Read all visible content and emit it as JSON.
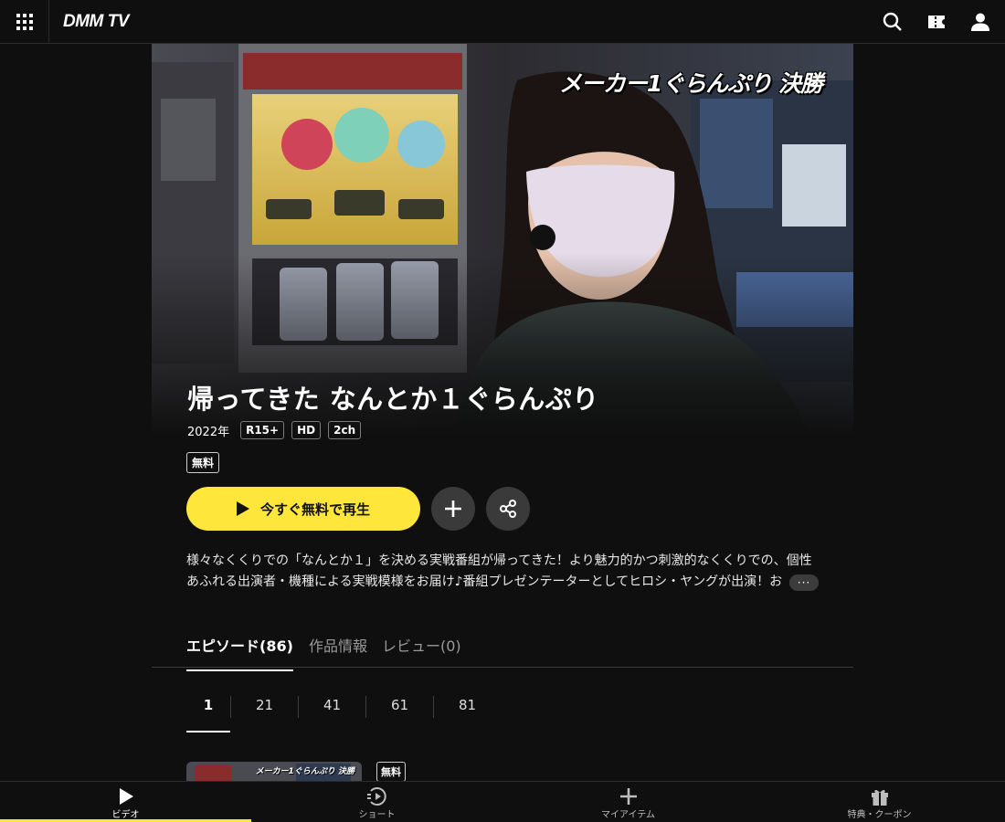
{
  "header": {
    "logo": "DMM TV",
    "menu_icon": "grid-menu-icon",
    "icons": [
      "search-icon",
      "ticket-icon",
      "user-icon"
    ]
  },
  "hero": {
    "caption": "メーカー1ぐらんぷり 決勝"
  },
  "title": "帰ってきた なんとか１ぐらんぷり",
  "meta": {
    "year": "2022年",
    "tags": [
      "R15+",
      "HD",
      "2ch"
    ]
  },
  "free_badge": "無料",
  "actions": {
    "play_label": "今すぐ無料で再生",
    "add_icon": "plus-icon",
    "share_icon": "share-icon"
  },
  "description": {
    "line1": "様々なくくりでの「なんとか１」を決める実戦番組が帰ってきた！より魅力的かつ刺激的なくくりでの、個性",
    "line2": "あふれる出演者・機種による実戦模様をお届け♪番組プレゼンテーターとしてヒロシ・ヤングが出演！お",
    "more": "···"
  },
  "tabs": [
    {
      "label": "エピソード(86)",
      "active": true
    },
    {
      "label": "作品情報",
      "active": false
    },
    {
      "label": "レビュー(0)",
      "active": false
    }
  ],
  "pager": [
    "1",
    "21",
    "41",
    "61",
    "81"
  ],
  "episode": {
    "thumb_caption": "メーカー1ぐらんぷり 決勝",
    "free_badge": "無料"
  },
  "bottom_nav": [
    {
      "label": "ビデオ",
      "icon": "play-icon",
      "active": true
    },
    {
      "label": "ショート",
      "icon": "short-play-icon",
      "active": false
    },
    {
      "label": "マイアイテム",
      "icon": "plus-icon",
      "active": false
    },
    {
      "label": "特典・クーポン",
      "icon": "gift-icon",
      "active": false
    }
  ],
  "colors": {
    "accent": "#ffe63a",
    "background": "#0f0f0f"
  }
}
